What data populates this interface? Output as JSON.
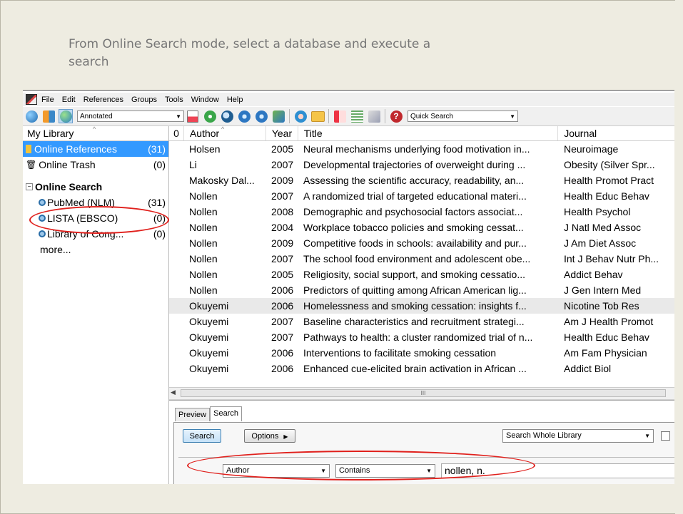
{
  "caption": "From Online Search mode, select a database and execute a search",
  "menu": [
    "File",
    "Edit",
    "References",
    "Groups",
    "Tools",
    "Window",
    "Help"
  ],
  "toolbar": {
    "style_select": "Annotated",
    "quick_search_placeholder": "Quick Search"
  },
  "left_panel": {
    "header": "My Library",
    "online_references": {
      "label": "Online References",
      "count": "(31)"
    },
    "online_trash": {
      "label": "Online Trash",
      "count": "(0)"
    },
    "online_search_header": "Online Search",
    "databases": [
      {
        "label": "PubMed (NLM)",
        "count": "(31)"
      },
      {
        "label": "LISTA (EBSCO)",
        "count": "(0)"
      },
      {
        "label": "Library of Cong...",
        "count": "(0)"
      }
    ],
    "more": "more..."
  },
  "table": {
    "columns": {
      "clip": "0",
      "author": "Author",
      "year": "Year",
      "title": "Title",
      "journal": "Journal"
    },
    "rows": [
      {
        "author": "Holsen",
        "year": "2005",
        "title": "Neural mechanisms underlying food motivation in...",
        "journal": "Neuroimage"
      },
      {
        "author": "Li",
        "year": "2007",
        "title": "Developmental trajectories of overweight during ...",
        "journal": "Obesity (Silver Spr..."
      },
      {
        "author": "Makosky Dal...",
        "year": "2009",
        "title": "Assessing the scientific accuracy, readability, an...",
        "journal": "Health Promot Pract"
      },
      {
        "author": "Nollen",
        "year": "2007",
        "title": "A randomized trial of targeted educational materi...",
        "journal": "Health Educ Behav"
      },
      {
        "author": "Nollen",
        "year": "2008",
        "title": "Demographic and psychosocial factors associat...",
        "journal": "Health Psychol"
      },
      {
        "author": "Nollen",
        "year": "2004",
        "title": "Workplace tobacco policies and smoking cessat...",
        "journal": "J Natl Med Assoc"
      },
      {
        "author": "Nollen",
        "year": "2009",
        "title": "Competitive foods in schools: availability and pur...",
        "journal": "J Am Diet Assoc"
      },
      {
        "author": "Nollen",
        "year": "2007",
        "title": "The school food environment and adolescent obe...",
        "journal": "Int J Behav Nutr Ph..."
      },
      {
        "author": "Nollen",
        "year": "2005",
        "title": "Religiosity, social support, and smoking cessatio...",
        "journal": "Addict Behav"
      },
      {
        "author": "Nollen",
        "year": "2006",
        "title": "Predictors of quitting among African American lig...",
        "journal": "J Gen Intern Med"
      },
      {
        "author": "Okuyemi",
        "year": "2006",
        "title": "Homelessness and smoking cessation: insights f...",
        "journal": "Nicotine Tob Res"
      },
      {
        "author": "Okuyemi",
        "year": "2007",
        "title": "Baseline characteristics and recruitment strategi...",
        "journal": "Am J Health Promot"
      },
      {
        "author": "Okuyemi",
        "year": "2007",
        "title": "Pathways to health: a cluster randomized trial of n...",
        "journal": "Health Educ Behav"
      },
      {
        "author": "Okuyemi",
        "year": "2006",
        "title": "Interventions to facilitate smoking cessation",
        "journal": "Am Fam Physician"
      },
      {
        "author": "Okuyemi",
        "year": "2006",
        "title": "Enhanced cue-elicited brain activation in African ...",
        "journal": "Addict Biol"
      }
    ],
    "scroll_grip": "III"
  },
  "bottom": {
    "tabs": [
      "Preview",
      "Search"
    ],
    "search_button": "Search",
    "options_button": "Options",
    "scope_select": "Search Whole Library",
    "field_select": "Author",
    "operator_select": "Contains",
    "search_value": "nollen, n."
  },
  "colors": {
    "accent": "#3399ff",
    "annotation": "#e0201c"
  }
}
